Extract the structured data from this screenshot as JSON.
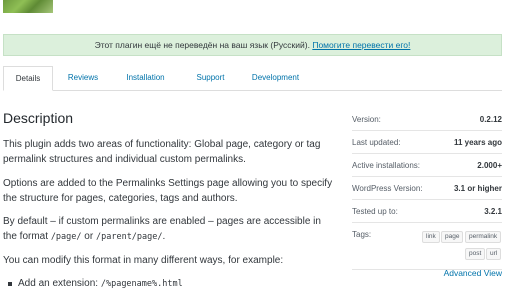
{
  "notice": {
    "text": "Этот плагин ещё не переведён на ваш язык (Русский).",
    "link": "Помогите перевести его!"
  },
  "tabs": [
    {
      "label": "Details",
      "active": true
    },
    {
      "label": "Reviews",
      "active": false
    },
    {
      "label": "Installation",
      "active": false
    },
    {
      "label": "Support",
      "active": false
    },
    {
      "label": "Development",
      "active": false
    }
  ],
  "description": {
    "title": "Description",
    "p1": "This plugin adds two areas of functionality: Global page, category or tag permalink structures and individual custom permalinks.",
    "p2": "Options are added to the Permalinks Settings page allowing you to specify the structure for pages, categories, tags and authors.",
    "p3_a": "By default – if custom permalinks are enabled – pages are accessible in the format ",
    "p3_code1": "/page/",
    "p3_or": " or ",
    "p3_code2": "/parent/page/",
    "p3_end": ".",
    "p4": "You can modify this format in many different ways, for example:",
    "bullet_text": "Add an extension: ",
    "bullet_code": "/%pagename%.html"
  },
  "meta": {
    "version_label": "Version:",
    "version_value": "0.2.12",
    "updated_label": "Last updated:",
    "updated_value": "11 years ago",
    "installs_label": "Active installations:",
    "installs_value": "2.000+",
    "wp_label": "WordPress Version:",
    "wp_value": "3.1 or higher",
    "tested_label": "Tested up to:",
    "tested_value": "3.2.1",
    "tags_label": "Tags:",
    "tags": [
      "link",
      "page",
      "permalink",
      "post",
      "url"
    ],
    "advanced": "Advanced View"
  }
}
